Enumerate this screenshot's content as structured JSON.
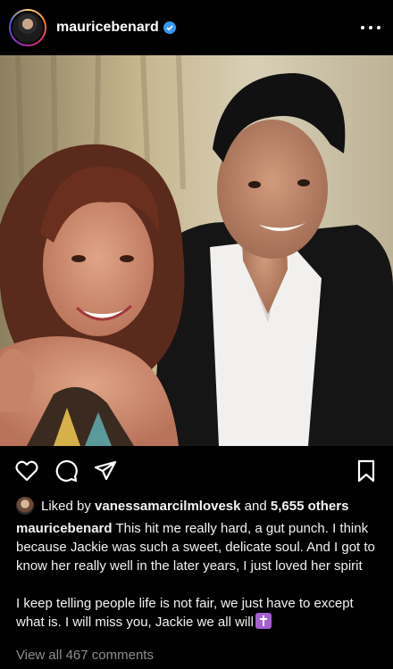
{
  "header": {
    "username": "mauricebenard",
    "verified_icon": "verified-badge-icon",
    "more_icon": "more-options-icon"
  },
  "post": {
    "image_alt": "Photo of a smiling woman with auburn curly hair and a man in a dark suit jacket with white shirt"
  },
  "actions": {
    "icons": [
      "heart-icon",
      "comment-icon",
      "share-icon",
      "bookmark-icon"
    ]
  },
  "likes": {
    "prefix": "Liked by",
    "liker": "vanessamarcilmlovesk",
    "conjunction": "and",
    "others": "5,655 others"
  },
  "caption": {
    "username": "mauricebenard",
    "text1": "This hit me really hard, a gut punch. I think because Jackie was such a sweet, delicate soul. And I got to know her really well in the later years, I just loved her spirit",
    "text2": "I keep telling people life is not fair, we just have to except what is. I will miss you, Jackie we all will",
    "emoji": "cross-emoji"
  },
  "comments": {
    "view_all": "View all 467 comments"
  },
  "colors": {
    "background": "#000000",
    "muted_text": "#8e8e8e",
    "verified": "#3897f0"
  }
}
